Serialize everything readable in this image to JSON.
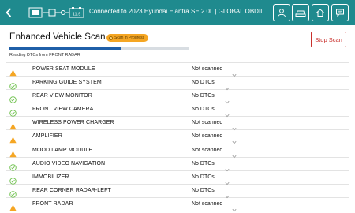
{
  "header": {
    "connection_text": "Connected to 2023 Hyundai Elantra SE 2.0L | GLOBAL OBDII",
    "battery_voltage": "11.9",
    "icons": [
      "back-icon",
      "user-icon",
      "vehicle-icon",
      "home-icon",
      "message-icon"
    ]
  },
  "scan": {
    "title": "Enhanced Vehicle Scan",
    "badge": "Scan in Progress",
    "stop_label": "Stop Scan",
    "status_text": "Reading DTCs from FRONT RADAR",
    "progress_fraction": 0.62
  },
  "colors": {
    "accent": "#1f8a8e",
    "warning": "#f5a623",
    "ok": "#6cc04a",
    "stop": "#c9302c"
  },
  "modules": [
    {
      "name": "POWER SEAT MODULE",
      "status": "Not scanned",
      "state": "warning"
    },
    {
      "name": "PARKING GUIDE SYSTEM",
      "status": "No DTCs",
      "state": "ok"
    },
    {
      "name": "REAR VIEW MONITOR",
      "status": "No DTCs",
      "state": "ok"
    },
    {
      "name": "FRONT VIEW CAMERA",
      "status": "No DTCs",
      "state": "ok"
    },
    {
      "name": "WIRELESS POWER CHARGER",
      "status": "Not scanned",
      "state": "warning"
    },
    {
      "name": "AMPLIFIER",
      "status": "Not scanned",
      "state": "warning"
    },
    {
      "name": "MOOD LAMP MODULE",
      "status": "Not scanned",
      "state": "warning"
    },
    {
      "name": "AUDIO VIDEO NAVIGATION",
      "status": "No DTCs",
      "state": "ok"
    },
    {
      "name": "IMMOBILIZER",
      "status": "No DTCs",
      "state": "ok"
    },
    {
      "name": "REAR CORNER RADAR-LEFT",
      "status": "No DTCs",
      "state": "ok"
    },
    {
      "name": "FRONT RADAR",
      "status": "Not scanned",
      "state": "warning"
    }
  ]
}
